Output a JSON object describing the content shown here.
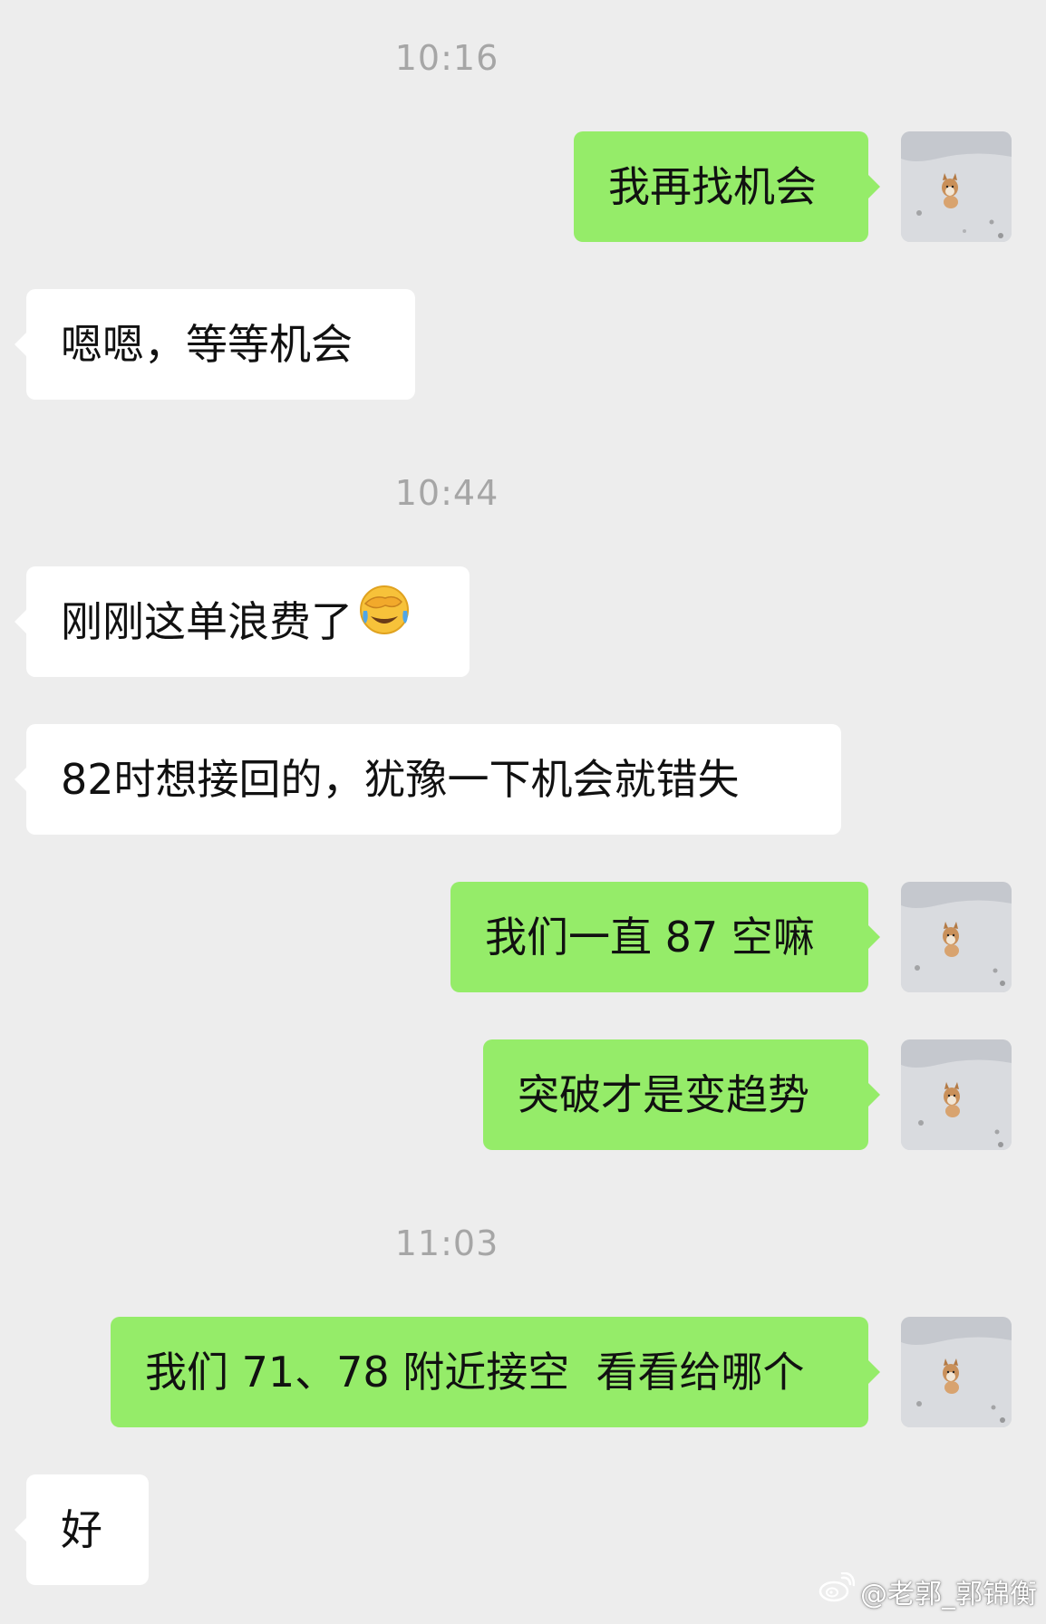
{
  "chat": {
    "timestamps": [
      "10:16",
      "10:44",
      "11:03"
    ],
    "messages": [
      {
        "text": "我再找机会",
        "from": "self"
      },
      {
        "text": "嗯嗯，等等机会",
        "from": "other"
      },
      {
        "text": "刚刚这单浪费了",
        "from": "other",
        "emoji": "face-palm-crying-emoji"
      },
      {
        "text": "82时想接回的，犹豫一下机会就错失",
        "from": "other"
      },
      {
        "text": "我们一直 87 空嘛",
        "from": "self"
      },
      {
        "text": "突破才是变趋势",
        "from": "self"
      },
      {
        "text": "我们 71、78 附近接空  看看给哪个",
        "from": "self"
      },
      {
        "text": "好",
        "from": "other"
      }
    ]
  },
  "watermark": {
    "icon": "weibo-icon",
    "text": "@老郭_郭锦衡"
  },
  "colors": {
    "background": "#ededed",
    "sent_bubble": "#95ec69",
    "received_bubble": "#ffffff",
    "timestamp": "#a6a6a6"
  }
}
